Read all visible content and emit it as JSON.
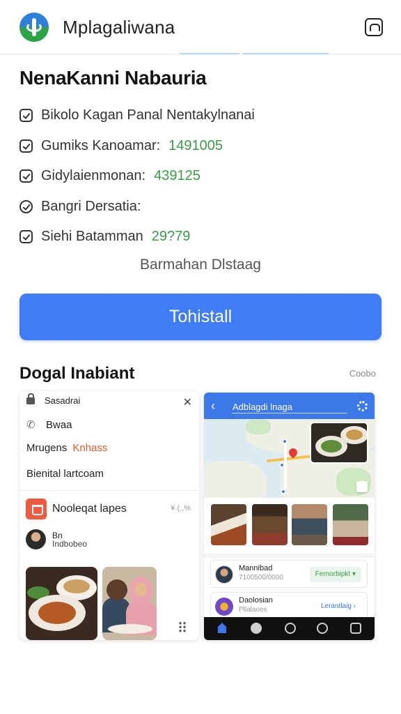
{
  "header": {
    "app_title": "Mplagaliwana",
    "logo_icon": "leaf-globe-logo",
    "action_icon": "camera-switch-icon"
  },
  "main": {
    "heading": "NenaKanni Nabauria",
    "details": [
      {
        "icon": "check-icon",
        "label": "Bikolo Kagan Panal Nentakylnanai",
        "value": ""
      },
      {
        "icon": "check-icon",
        "label": "Gumiks Kanoamar:",
        "value": "1491005"
      },
      {
        "icon": "check-icon",
        "label": "Gidylaienmonan:",
        "value": "439125"
      },
      {
        "icon": "circle-icon",
        "label": "Bangri Dersatia:",
        "value": ""
      },
      {
        "icon": "check-icon",
        "label": "Siehi Batamman",
        "value": "29?79"
      }
    ],
    "sub_link": "Barmahan Dlstaag",
    "install_button": "Tohistall"
  },
  "section": {
    "title": "Dogal Inabiant",
    "more": "Coobo"
  },
  "left_card": {
    "row1": "Sasadrai",
    "row2": "Bwaa",
    "row3_label": "Mrugens",
    "row3_link": "Knhass",
    "row4": "Bienital lartcoam",
    "app_name": "Nooleqat lapes",
    "app_meta": "¥.(,,%",
    "user_line1": "Bn",
    "user_line2": "Indbobeo"
  },
  "right_card": {
    "title": "Adblagdi lnaga",
    "items": [
      {
        "name": "Mannibad",
        "sub": "7100500/0000",
        "action": "Fernorbipkt"
      },
      {
        "name": "Daolosian",
        "sub": "Pllalaoes",
        "action": "Lerantlaig"
      }
    ]
  },
  "colors": {
    "accent": "#3f7cf6",
    "success": "#3a9c47",
    "link": "#e6592d",
    "nav_bg": "#111111"
  }
}
